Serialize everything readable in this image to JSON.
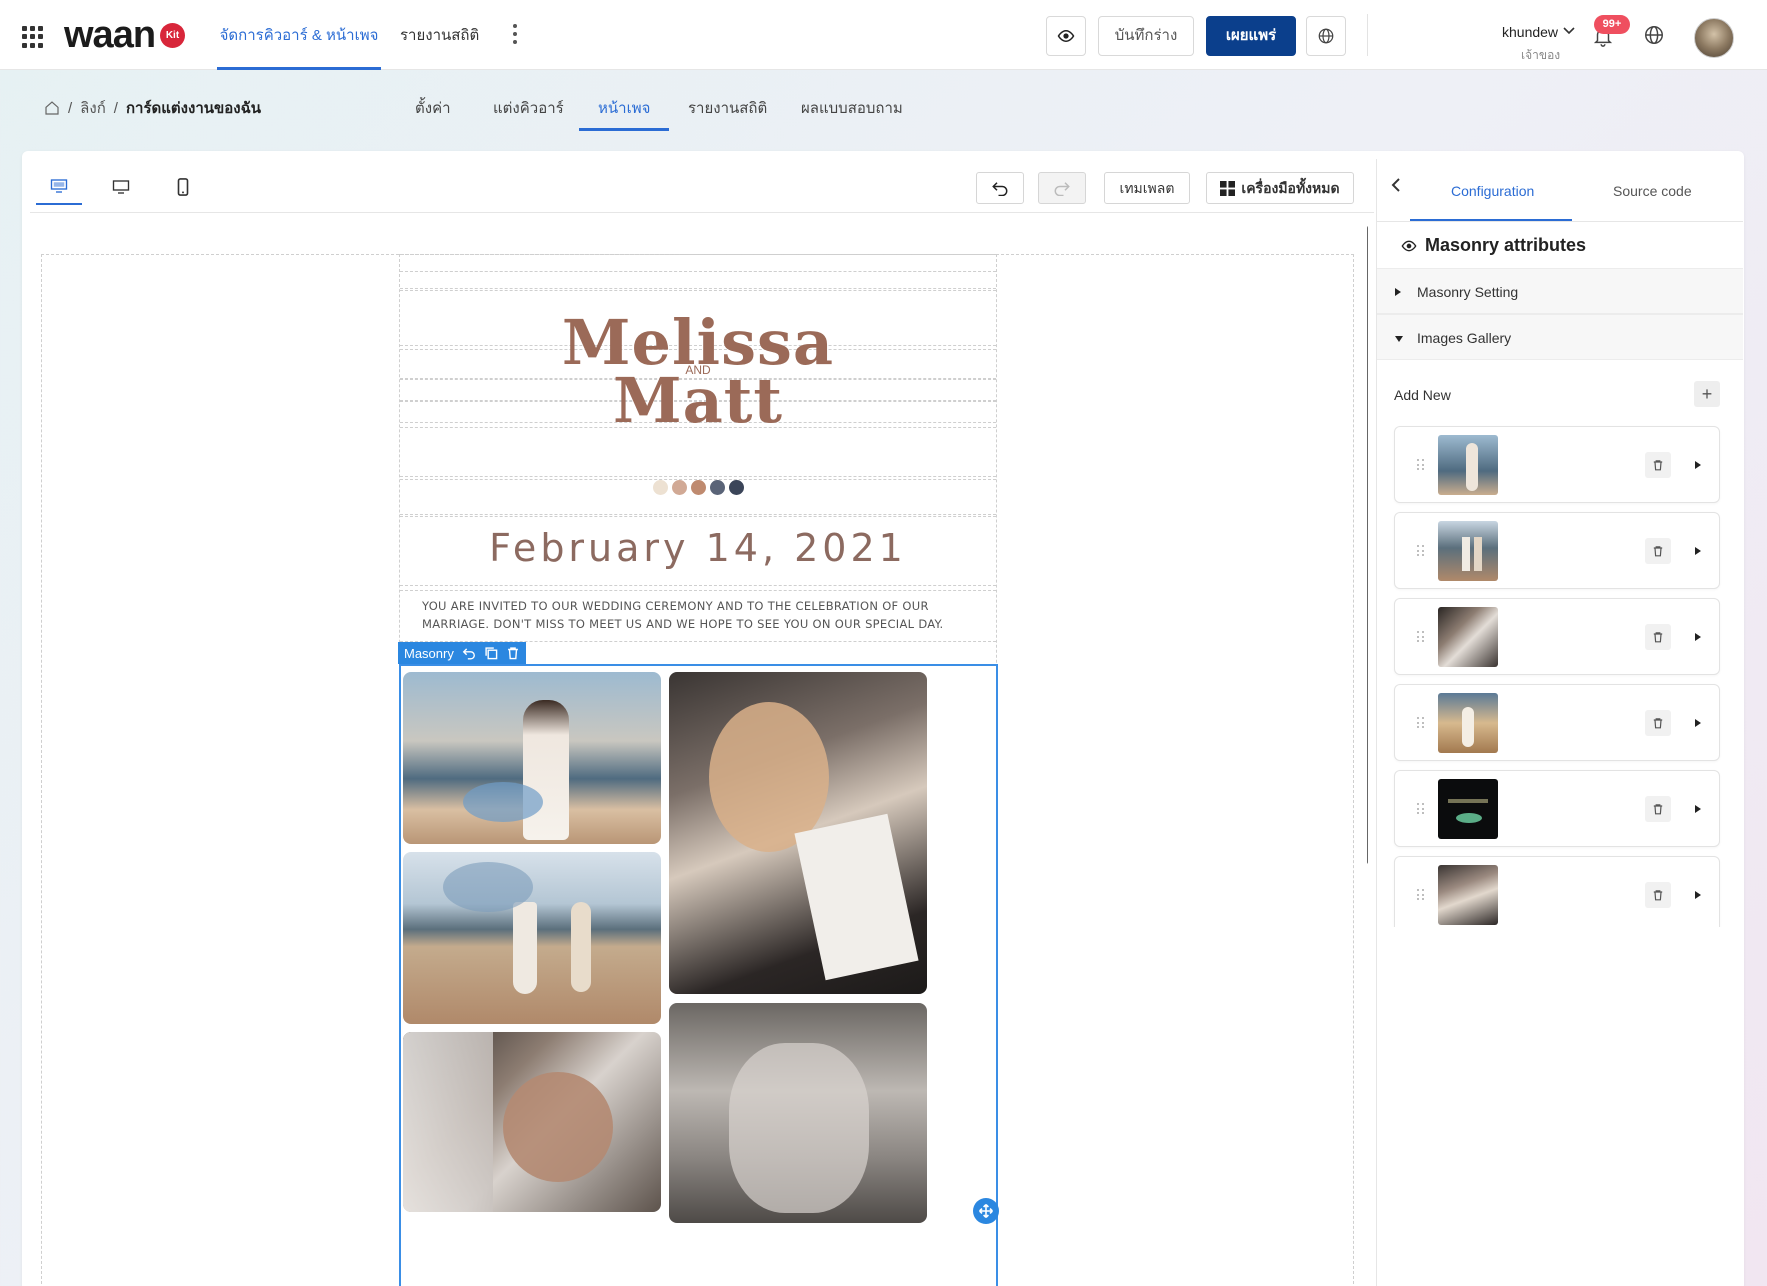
{
  "app": {
    "logo_text": "waan",
    "logo_badge": "Kit"
  },
  "topnav": {
    "items": [
      {
        "label": "จัดการคิวอาร์ & หน้าเพจ",
        "active": true
      },
      {
        "label": "รายงานสถิติ",
        "active": false
      }
    ],
    "more_icon": "kebab-icon"
  },
  "actions": {
    "preview_icon": "eye-icon",
    "save_draft": "บันทึกร่าง",
    "publish": "เผยแพร่",
    "globe_icon": "globe-icon"
  },
  "user": {
    "name": "khundew",
    "role": "เจ้าของ",
    "notifications": "99+"
  },
  "breadcrumb": {
    "items": [
      "ลิงก์",
      "การ์ดแต่งงานของฉัน"
    ]
  },
  "subtabs": [
    {
      "label": "ตั้งค่า",
      "active": false
    },
    {
      "label": "แต่งคิวอาร์",
      "active": false
    },
    {
      "label": "หน้าเพจ",
      "active": true
    },
    {
      "label": "รายงานสถิติ",
      "active": false
    },
    {
      "label": "ผลแบบสอบถาม",
      "active": false
    }
  ],
  "toolbar": {
    "devices": [
      "desktop-large-icon",
      "desktop-icon",
      "mobile-icon"
    ],
    "undo_icon": "undo-icon",
    "redo_icon": "redo-icon",
    "template": "เทมเพลต",
    "all_tools": "เครื่องมือทั้งหมด"
  },
  "card": {
    "name1": "Melissa",
    "and": "AND",
    "name2": "Matt",
    "palette": [
      "#ede1d2",
      "#d1a995",
      "#bf8a6f",
      "#5a6478",
      "#3b4559"
    ],
    "date": "February 14, 2021",
    "invite": "You are invited to our wedding ceremony and to the celebration of our marriage. Don't miss to meet us and we hope to see you on our special day.",
    "masonry_label": "Masonry"
  },
  "panel": {
    "tabs": [
      {
        "label": "Configuration",
        "active": true
      },
      {
        "label": "Source code",
        "active": false
      }
    ],
    "title": "Masonry attributes",
    "sections": [
      {
        "label": "Masonry Setting",
        "expanded": false
      },
      {
        "label": "Images Gallery",
        "expanded": true
      }
    ],
    "add_new": "Add New",
    "gallery_count": 6
  }
}
